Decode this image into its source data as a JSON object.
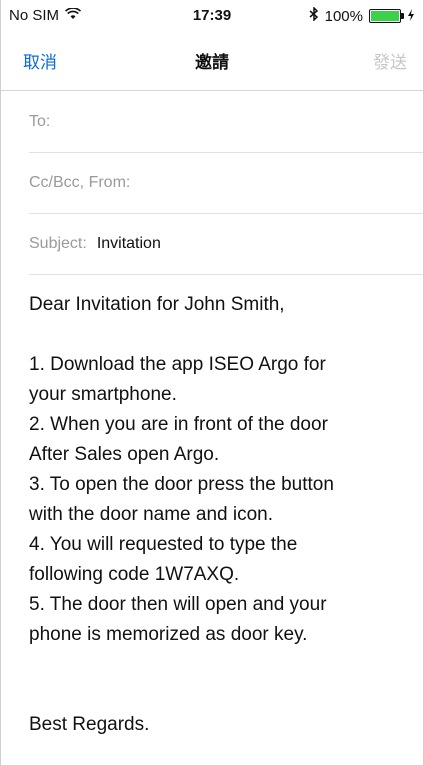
{
  "status_bar": {
    "carrier": "No SIM",
    "time": "17:39",
    "battery": "100%",
    "icons": [
      "wifi-icon",
      "bluetooth-icon",
      "battery-icon",
      "charging-icon"
    ]
  },
  "nav": {
    "cancel": "取消",
    "title": "邀請",
    "send": "發送"
  },
  "fields": {
    "to_label": "To:",
    "cc_label": "Cc/Bcc, From:",
    "subject_label": "Subject:",
    "subject_value": "Invitation"
  },
  "body": {
    "greeting": "Dear Invitation for John Smith,",
    "lines": [
      "1. Download the app ISEO Argo for",
      "your smartphone.",
      "2. When you are in front of the door",
      "After Sales open Argo.",
      "3. To open the door press the button",
      "with the door name and icon.",
      "4. You will requested to type the",
      "following code 1W7AXQ.",
      "5. The door then will open and your",
      "phone is memorized as door key."
    ],
    "closing": "Best Regards."
  },
  "colors": {
    "accent": "#0a6bd8",
    "disabled": "#c7c7c7",
    "battery": "#3bd14b"
  }
}
